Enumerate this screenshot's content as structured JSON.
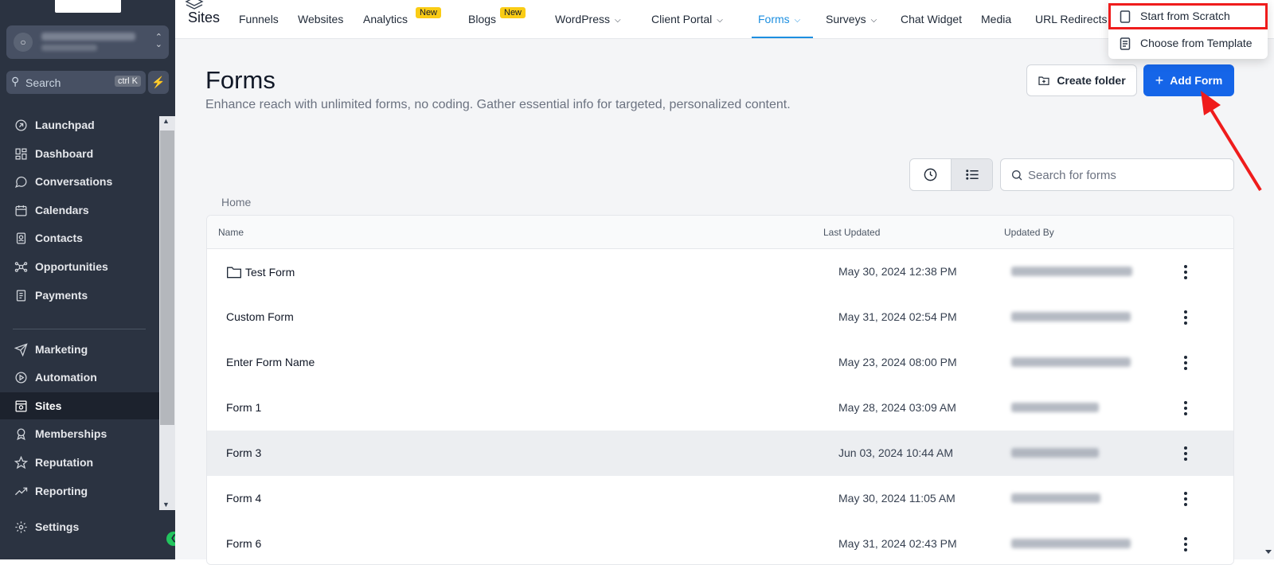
{
  "sidebar": {
    "search_placeholder": "Search",
    "search_shortcut": "ctrl K",
    "items": [
      {
        "label": "Launchpad",
        "icon": "rocket-icon"
      },
      {
        "label": "Dashboard",
        "icon": "dashboard-icon"
      },
      {
        "label": "Conversations",
        "icon": "chat-icon"
      },
      {
        "label": "Calendars",
        "icon": "calendar-icon"
      },
      {
        "label": "Contacts",
        "icon": "contacts-icon"
      },
      {
        "label": "Opportunities",
        "icon": "opportunities-icon"
      },
      {
        "label": "Payments",
        "icon": "payments-icon"
      },
      {
        "label": "Marketing",
        "icon": "send-icon"
      },
      {
        "label": "Automation",
        "icon": "automation-icon"
      },
      {
        "label": "Sites",
        "icon": "sites-icon"
      },
      {
        "label": "Memberships",
        "icon": "badge-icon"
      },
      {
        "label": "Reputation",
        "icon": "star-icon"
      },
      {
        "label": "Reporting",
        "icon": "trend-icon"
      },
      {
        "label": "Settings",
        "icon": "gear-icon"
      }
    ]
  },
  "topbar": {
    "brand": "Sites",
    "tabs": [
      {
        "label": "Funnels"
      },
      {
        "label": "Websites"
      },
      {
        "label": "Analytics",
        "badge": "New"
      },
      {
        "label": "Blogs",
        "badge": "New"
      },
      {
        "label": "WordPress"
      },
      {
        "label": "Client Portal"
      },
      {
        "label": "Forms"
      },
      {
        "label": "Surveys"
      },
      {
        "label": "Chat Widget"
      },
      {
        "label": "Media"
      },
      {
        "label": "URL Redirects"
      }
    ]
  },
  "dropdown": {
    "items": [
      {
        "label": "Start from Scratch"
      },
      {
        "label": "Choose from Template"
      }
    ]
  },
  "main": {
    "title": "Forms",
    "description": "Enhance reach with unlimited forms, no coding. Gather essential info for targeted, personalized content.",
    "create_folder_label": "Create folder",
    "add_form_label": "Add Form",
    "search_placeholder": "Search for forms",
    "breadcrumb": "Home"
  },
  "table": {
    "columns": [
      "Name",
      "Last Updated",
      "Updated By"
    ],
    "rows": [
      {
        "name": "Test Form",
        "updated": "May 30, 2024 12:38 PM"
      },
      {
        "name": "Custom Form",
        "updated": "May 31, 2024 02:54 PM"
      },
      {
        "name": "Enter Form Name",
        "updated": "May 23, 2024 08:00 PM"
      },
      {
        "name": "Form 1",
        "updated": "May 28, 2024 03:09 AM"
      },
      {
        "name": "Form 3",
        "updated": "Jun 03, 2024 10:44 AM"
      },
      {
        "name": "Form 4",
        "updated": "May 30, 2024 11:05 AM"
      },
      {
        "name": "Form 6",
        "updated": "May 31, 2024 02:43 PM"
      }
    ]
  },
  "colors": {
    "sidebar_bg": "#2b3341",
    "accent": "#1565e8",
    "active_tab": "#1d8fe0",
    "highlight": "#ef1c1c",
    "new_badge": "#facc15"
  }
}
